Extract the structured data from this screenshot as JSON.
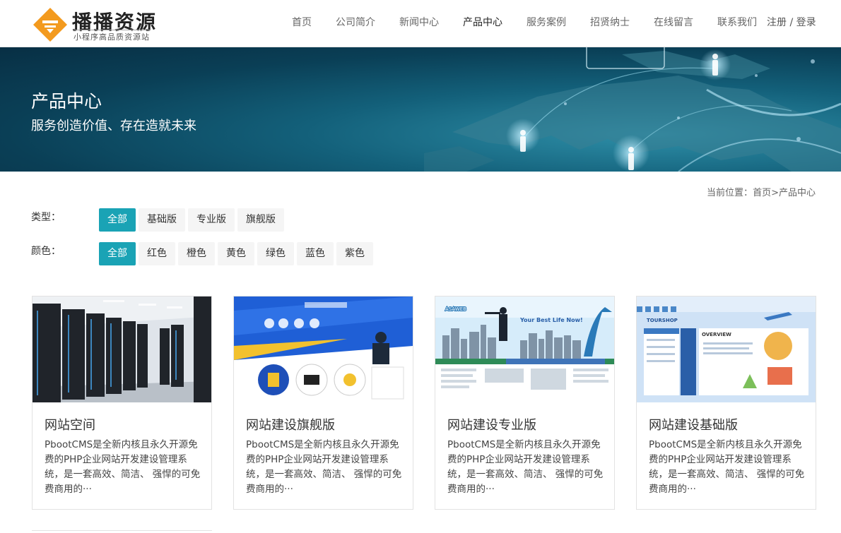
{
  "header": {
    "logo_title": "播播资源",
    "logo_sub": "小程序高品质资源站",
    "nav": [
      "首页",
      "公司简介",
      "新闻中心",
      "产品中心",
      "服务案例",
      "招贤纳士",
      "在线留言",
      "联系我们"
    ],
    "active_nav": "产品中心",
    "register": "注册",
    "separator": " / ",
    "login": "登录"
  },
  "banner": {
    "title": "产品中心",
    "subtitle": "服务创造价值、存在造就未来"
  },
  "breadcrumb": {
    "prefix": "当前位置：",
    "home": "首页",
    "sep": ">",
    "current": "产品中心"
  },
  "filters": {
    "type_label": "类型：",
    "type_options": [
      "全部",
      "基础版",
      "专业版",
      "旗舰版"
    ],
    "color_label": "颜色：",
    "color_options": [
      "全部",
      "红色",
      "橙色",
      "黄色",
      "绿色",
      "蓝色",
      "紫色"
    ],
    "accent": "#1aa3b5"
  },
  "products": [
    {
      "title": "网站空间",
      "desc": "PbootCMS是全新内核且永久开源免费的PHP企业网站开发建设管理系统，是一套高效、简洁、 强悍的可免费商用的···",
      "image": "server-room"
    },
    {
      "title": "网站建设旗舰版",
      "desc": "PbootCMS是全新内核且永久开源免费的PHP企业网站开发建设管理系统，是一套高效、简洁、 强悍的可免费商用的···",
      "image": "flagship-template"
    },
    {
      "title": "网站建设专业版",
      "desc": "PbootCMS是全新内核且永久开源免费的PHP企业网站开发建设管理系统，是一套高效、简洁、 强悍的可免费商用的···",
      "image": "asaweb-template"
    },
    {
      "title": "网站建设基础版",
      "desc": "PbootCMS是全新内核且永久开源免费的PHP企业网站开发建设管理系统，是一套高效、简洁、 强悍的可免费商用的···",
      "image": "tourshop-template"
    }
  ],
  "thumbnail_text": {
    "asaweb": "ASAWEB",
    "best_life": "Your Best Life Now!",
    "tourshop": "TOURSHOP",
    "overview": "OVERVIEW"
  }
}
